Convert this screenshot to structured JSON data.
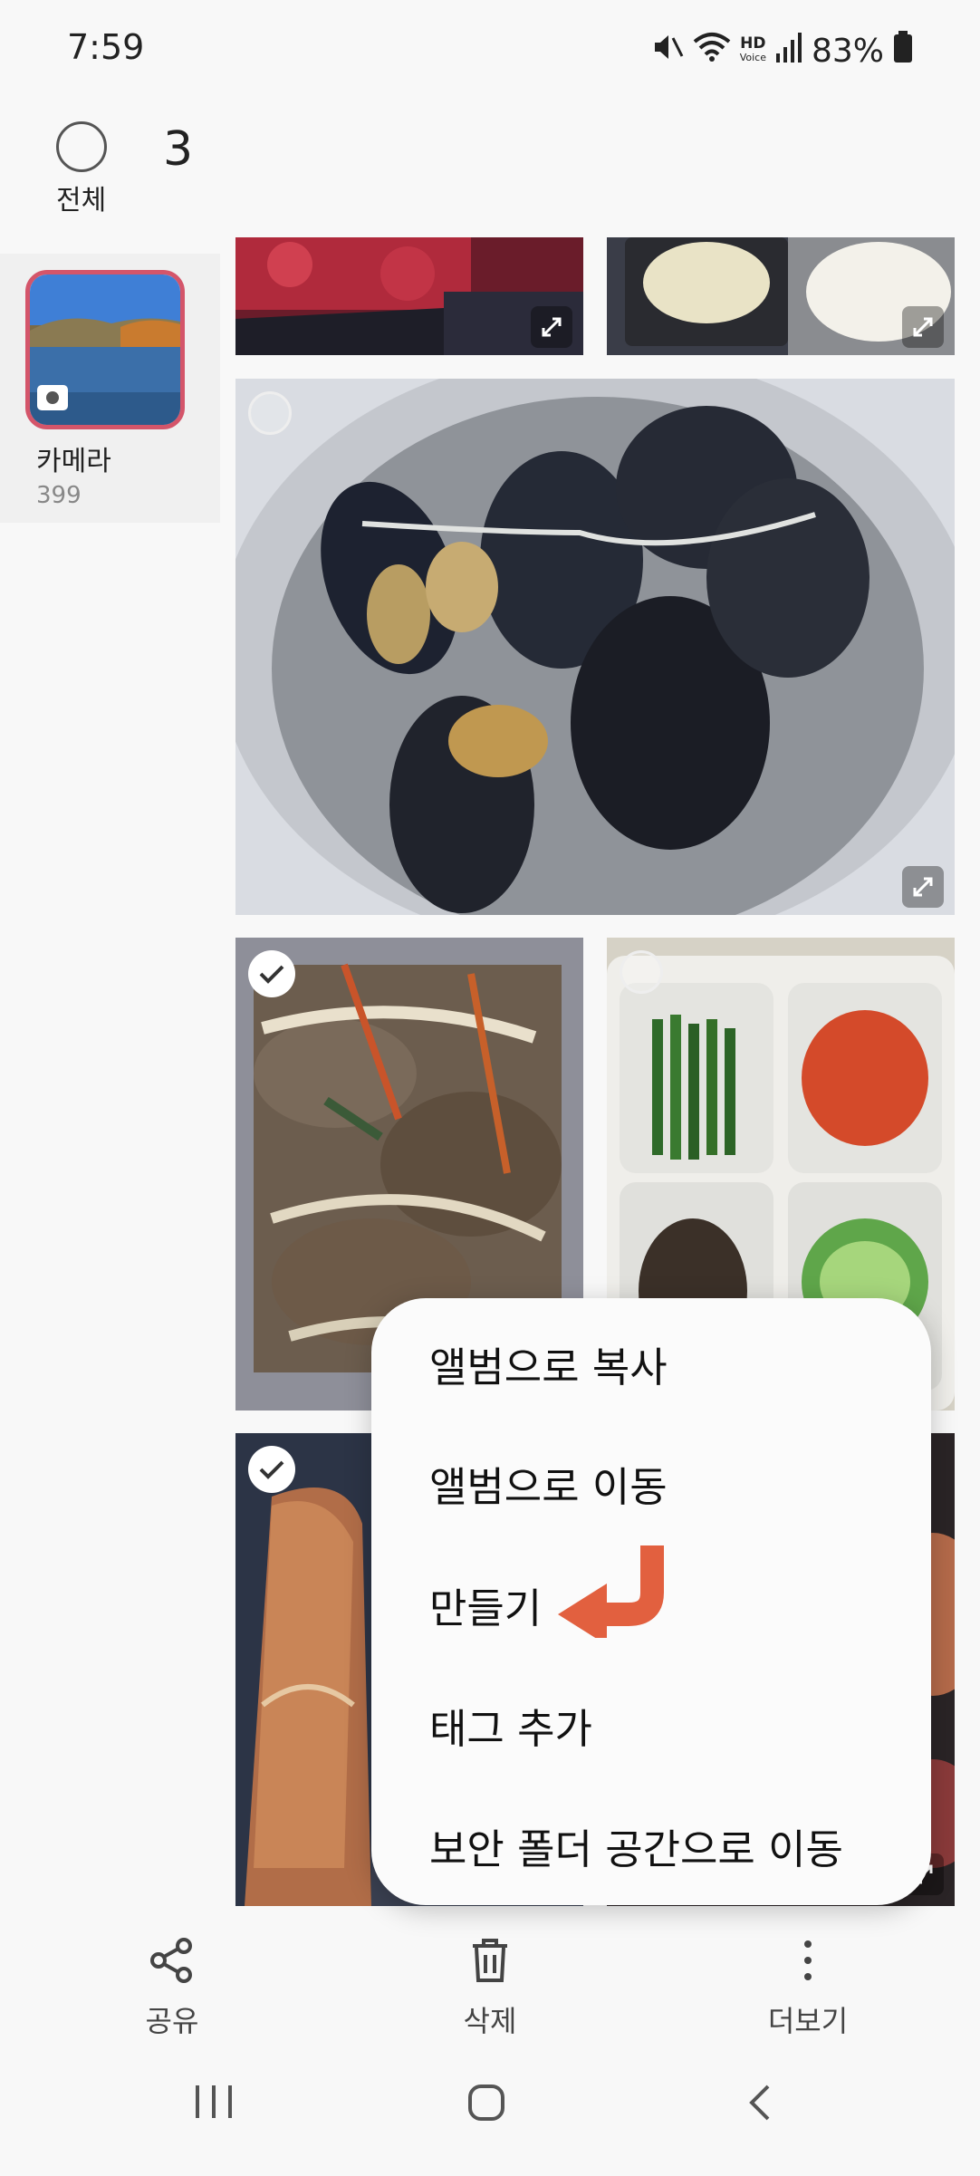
{
  "status_bar": {
    "time": "7:59",
    "battery": "83%",
    "icons": [
      "mute-icon",
      "wifi-icon",
      "hd-voice-icon",
      "signal-icon",
      "battery-icon"
    ],
    "hd_label": "HD",
    "voice_label": "Voice"
  },
  "selection": {
    "all_label": "전체",
    "count": "3"
  },
  "album": {
    "name": "카메라",
    "count": "399"
  },
  "menu": {
    "items": [
      "앨범으로 복사",
      "앨범으로 이동",
      "만들기",
      "태그 추가",
      "보안 폴더 공간으로 이동"
    ]
  },
  "actions": {
    "share": "공유",
    "delete": "삭제",
    "more": "더보기"
  },
  "colors": {
    "accent_border": "#d4556a",
    "arrow": "#e2603f"
  }
}
